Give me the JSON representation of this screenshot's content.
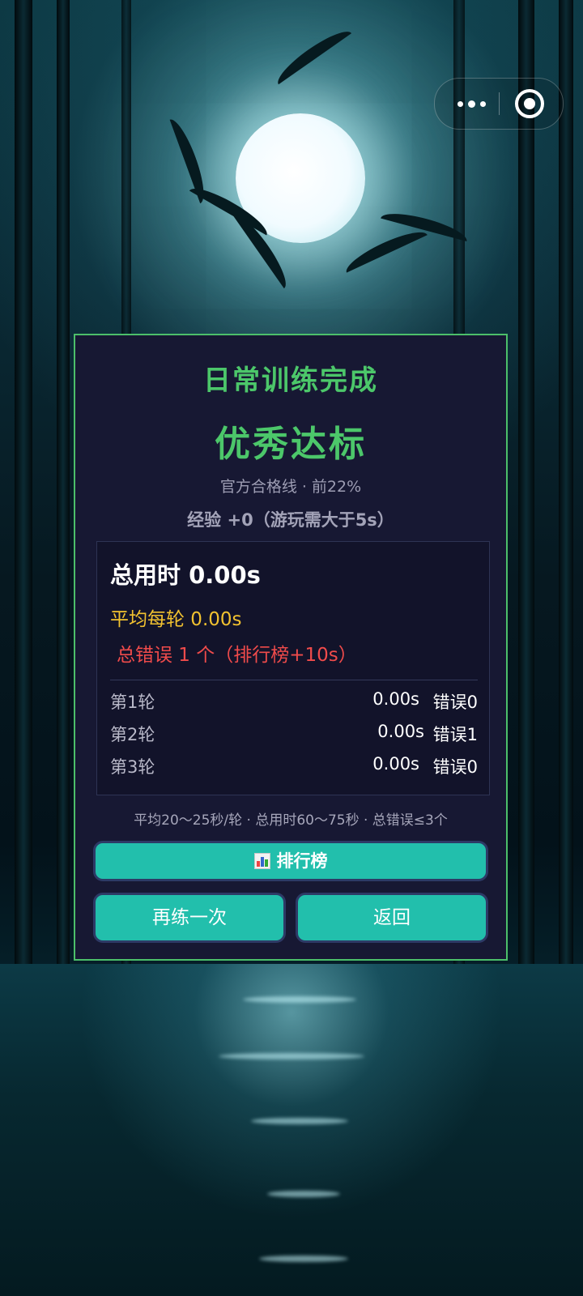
{
  "capsule": {
    "more_icon": "more-dots-icon",
    "close_icon": "target-circle-icon"
  },
  "result": {
    "title": "日常训练完成",
    "grade": "优秀达标",
    "pass_line": "官方合格线 · 前22%",
    "exp": "经验 +0（游玩需大于5s）"
  },
  "stats": {
    "total_time": "总用时 0.00s",
    "avg_time": "平均每轮 0.00s",
    "errors": "总错误 1 个（排行榜+10s）",
    "rounds": [
      {
        "name": "第1轮",
        "time": "0.00s",
        "errors": "错误0"
      },
      {
        "name": "第2轮",
        "time": "0.00s",
        "errors": "错误1"
      },
      {
        "name": "第3轮",
        "time": "0.00s",
        "errors": "错误0"
      }
    ]
  },
  "criteria": "平均20～25秒/轮 · 总用时60～75秒 · 总错误≤3个",
  "buttons": {
    "leaderboard": "排行榜",
    "leaderboard_icon": "bar-chart-icon",
    "retry": "再练一次",
    "back": "返回"
  },
  "colors": {
    "panel_bg": "#171833",
    "panel_border": "#4cbf6a",
    "title_green": "#4cc76a",
    "avg_yellow": "#f2c230",
    "error_red": "#f04b4b",
    "button_teal": "#22bfac"
  }
}
